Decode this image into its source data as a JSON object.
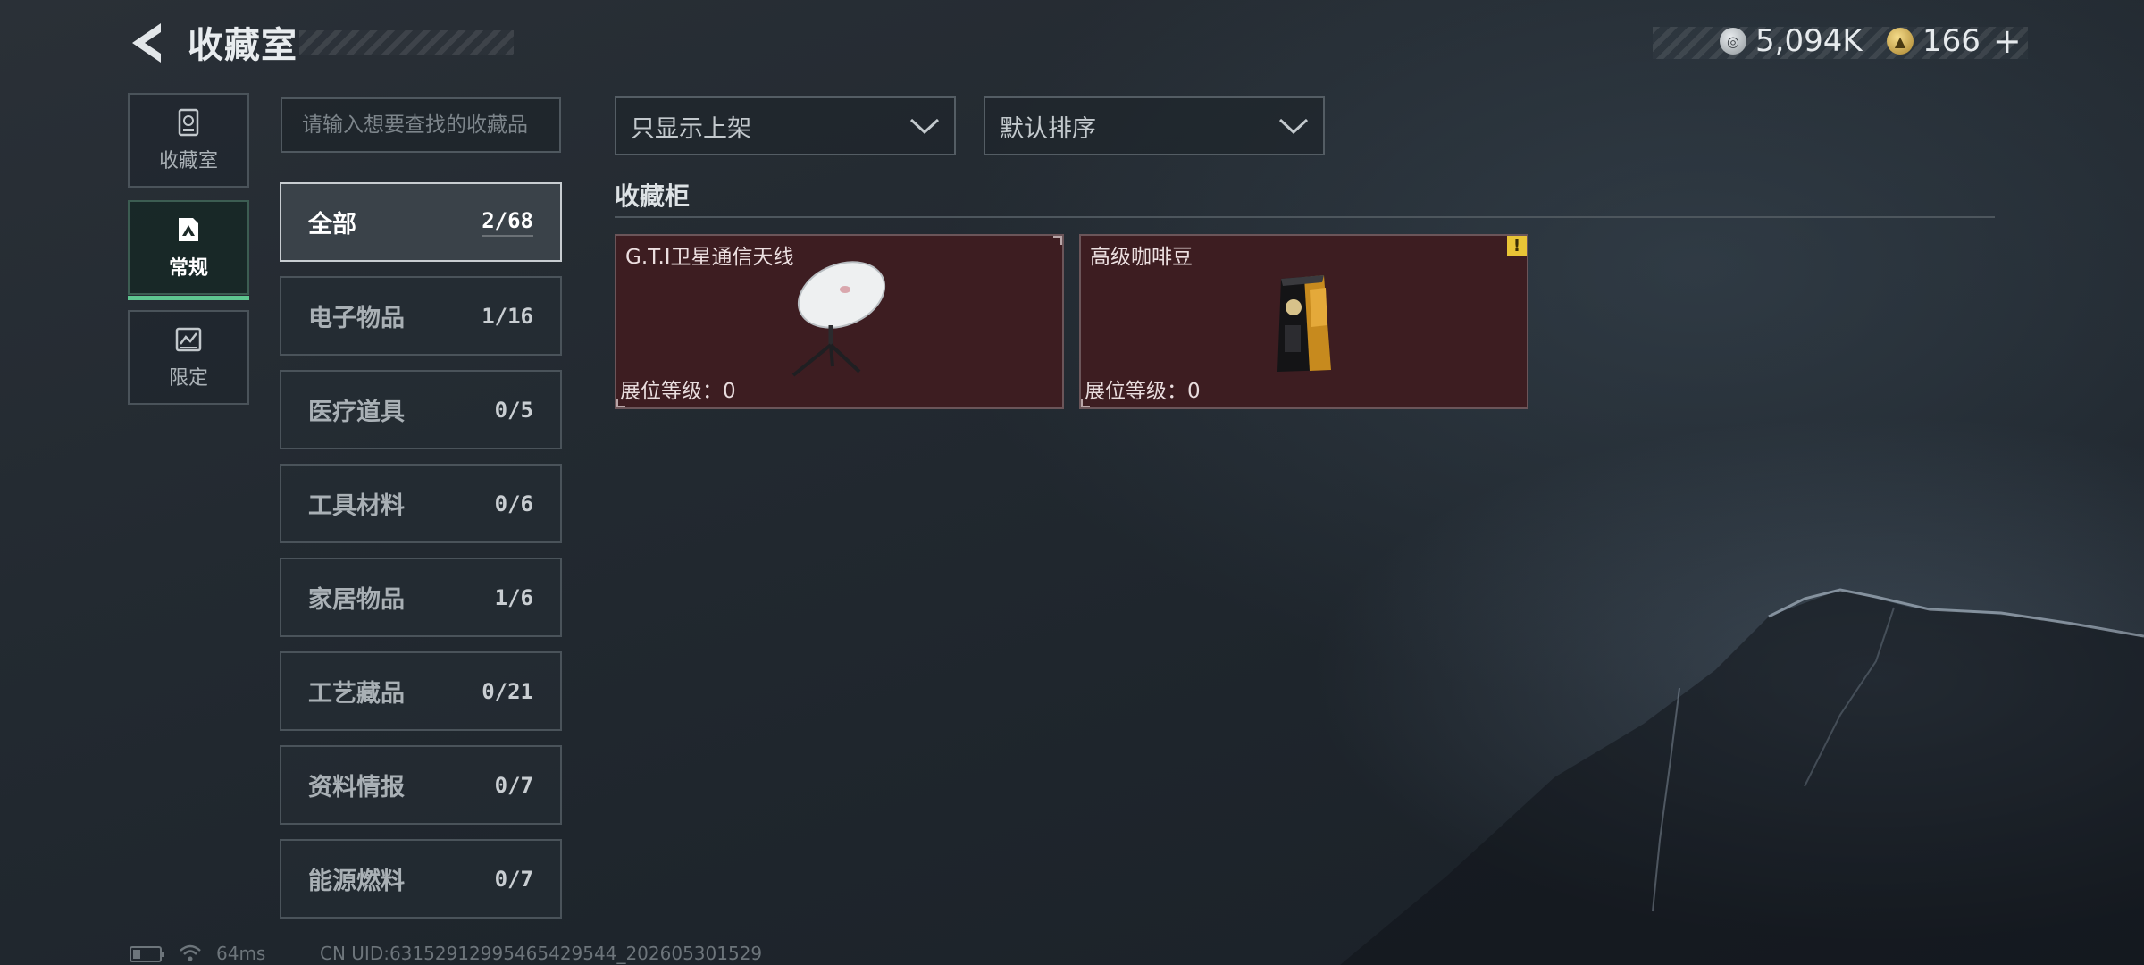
{
  "header": {
    "title": "收藏室",
    "currency_silver": "5,094K",
    "currency_gold": "166",
    "currency_plus": "+"
  },
  "nav": {
    "items": [
      {
        "label": "收藏室",
        "icon": "collection-room-icon",
        "active": false
      },
      {
        "label": "常规",
        "icon": "regular-icon",
        "active": true
      },
      {
        "label": "限定",
        "icon": "limited-icon",
        "active": false
      }
    ]
  },
  "search": {
    "placeholder": "请输入想要查找的收藏品",
    "value": ""
  },
  "categories": [
    {
      "label": "全部",
      "count": "2/68",
      "active": true
    },
    {
      "label": "电子物品",
      "count": "1/16",
      "active": false
    },
    {
      "label": "医疗道具",
      "count": "0/5",
      "active": false
    },
    {
      "label": "工具材料",
      "count": "0/6",
      "active": false
    },
    {
      "label": "家居物品",
      "count": "1/6",
      "active": false
    },
    {
      "label": "工艺藏品",
      "count": "0/21",
      "active": false
    },
    {
      "label": "资料情报",
      "count": "0/7",
      "active": false
    },
    {
      "label": "能源燃料",
      "count": "0/7",
      "active": false
    }
  ],
  "filters": {
    "listing_filter": "只显示上架",
    "sort": "默认排序"
  },
  "cabinet": {
    "title": "收藏柜",
    "items": [
      {
        "name": "G.T.I卫星通信天线",
        "level_label": "展位等级：",
        "level": "0",
        "icon": "satellite-antenna-icon",
        "warning": false
      },
      {
        "name": "高级咖啡豆",
        "level_label": "展位等级：",
        "level": "0",
        "icon": "coffee-bag-icon",
        "warning": true,
        "warning_mark": "!"
      }
    ]
  },
  "footer": {
    "ping": "64ms",
    "uid": "CN UID:631529129954654295​44_202605301529"
  },
  "colors": {
    "accent_green": "#5ec690",
    "card_bg": "#3d1d21",
    "warning_yellow": "#e9c436"
  }
}
